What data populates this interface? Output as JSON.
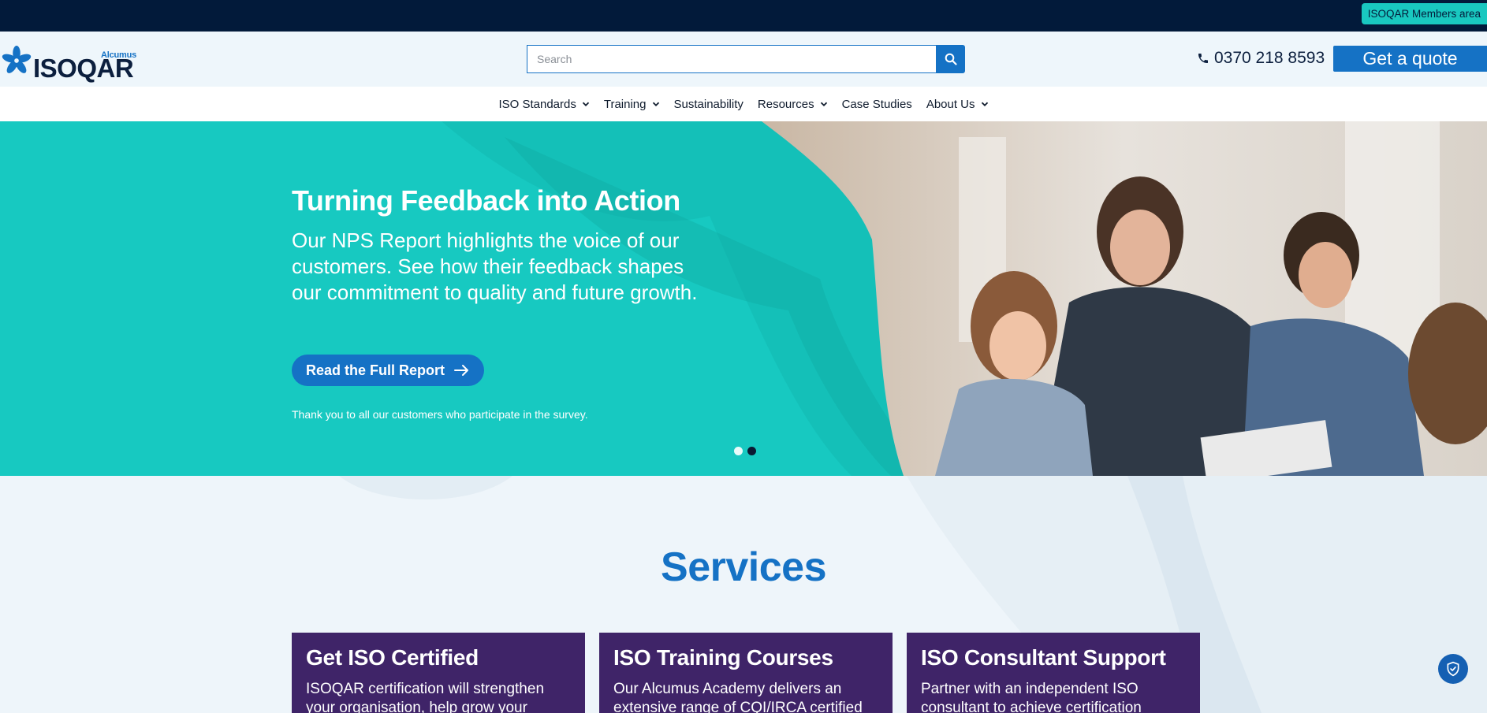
{
  "topbar": {
    "members_label": "ISOQAR Members area"
  },
  "logo": {
    "brand": "ISOQAR",
    "parent": "Alcumus"
  },
  "search": {
    "placeholder": "Search"
  },
  "contact": {
    "phone": "0370 218 8593",
    "quote_label": "Get a quote"
  },
  "nav": {
    "items": [
      {
        "label": "ISO Standards",
        "has_dropdown": true
      },
      {
        "label": "Training",
        "has_dropdown": true
      },
      {
        "label": "Sustainability",
        "has_dropdown": false
      },
      {
        "label": "Resources",
        "has_dropdown": true
      },
      {
        "label": "Case Studies",
        "has_dropdown": false
      },
      {
        "label": "About Us",
        "has_dropdown": true
      }
    ]
  },
  "hero": {
    "title": "Turning Feedback into Action",
    "body": "Our NPS Report highlights the voice of our customers. See how their feedback shapes our commitment to quality and future growth.",
    "cta_label": "Read the Full Report",
    "note": "Thank you to all our customers who participate in the survey.",
    "slides": 2,
    "active_slide": 2
  },
  "services": {
    "title": "Services",
    "cards": [
      {
        "title": "Get ISO Certified",
        "text": "ISOQAR certification will strengthen your organisation, help grow your"
      },
      {
        "title": "ISO Training Courses",
        "text": "Our Alcumus Academy delivers an extensive range of CQI/IRCA certified"
      },
      {
        "title": "ISO Consultant Support",
        "text": "Partner with an independent ISO consultant to achieve certification"
      }
    ]
  },
  "colors": {
    "navy": "#021a3a",
    "teal": "#17c9c1",
    "blue": "#1572c5",
    "purple": "#3f2468"
  }
}
